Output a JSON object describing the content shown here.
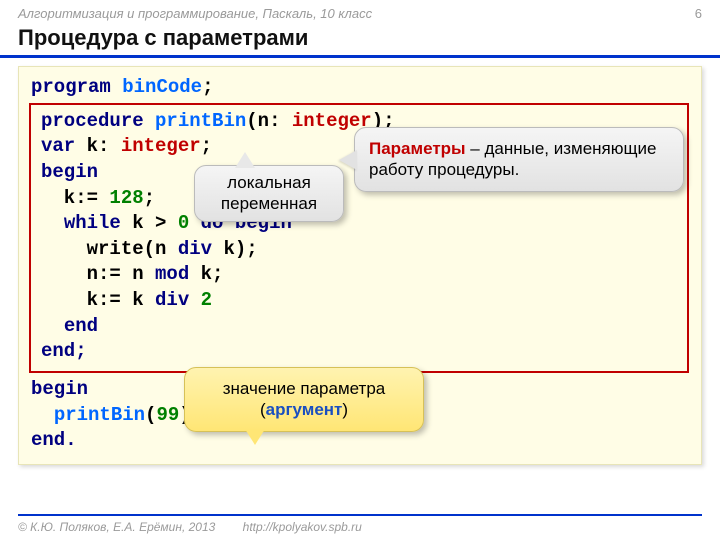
{
  "breadcrumb": "Алгоритмизация и программирование, Паскаль, 10 класс",
  "page_number": "6",
  "title": "Процедура с параметрами",
  "code": {
    "program_kw": "program",
    "program_name": "binCode",
    "semicolon": ";",
    "procedure_kw": "procedure",
    "proc_name": "printBin",
    "lparen": "(",
    "param_n": "n",
    "colon_sp": ": ",
    "int_type": "integer",
    "rparen_semi": ");",
    "var_kw": "var",
    "var_k": " k: ",
    "int_type2": "integer",
    "semi": ";",
    "begin_kw": "begin",
    "k_assign": "  k:= ",
    "num128": "128",
    "while_kw": "while",
    "while_cond_pre": " k > ",
    "zero": "0",
    "do_begin": "do begin",
    "write_line_pre": "    write(n ",
    "div_kw": "div",
    "write_line_post": " k);",
    "n_assign": "    n:= n ",
    "mod_kw": "mod",
    "post_k": " k;",
    "k_assign2": "    k:= k ",
    "div_kw2": "div",
    "sp2": " ",
    "two": "2",
    "end_kw": "end",
    "end_semi": "end;",
    "begin2": "begin",
    "call_indent": "  ",
    "call_name": "printBin",
    "lp": "(",
    "arg99": "99",
    "rp": ")",
    "end_dot": "end."
  },
  "callouts": {
    "local_var": "локальная переменная",
    "params_label": "Параметры",
    "params_text": " – данные, изменяющие работу процедуры.",
    "arg_text_pre": "значение параметра (",
    "arg_text_hl": "аргумент",
    "arg_text_post": ")"
  },
  "footer": {
    "copyright": "© К.Ю. Поляков, Е.А. Ерёмин, 2013",
    "url": "http://kpolyakov.spb.ru"
  }
}
